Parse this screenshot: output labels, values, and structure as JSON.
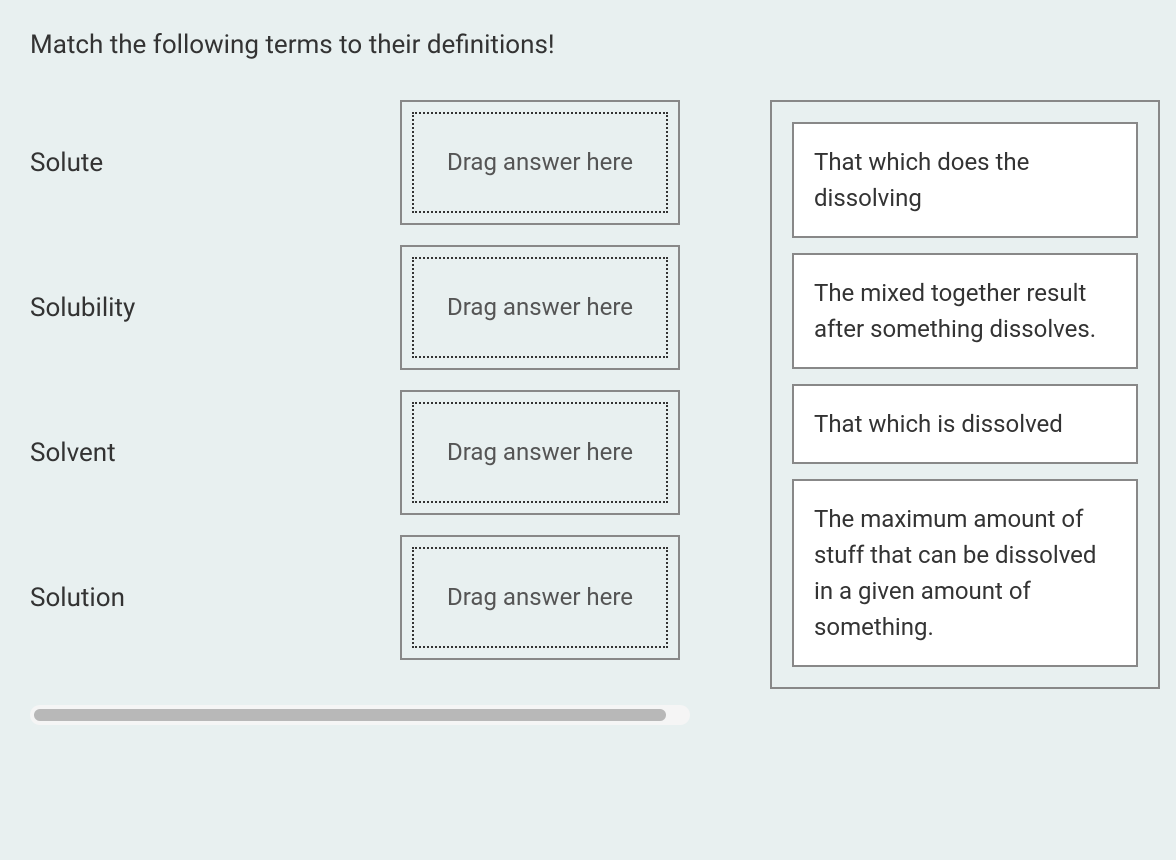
{
  "instruction": "Match the following terms to their definitions!",
  "terms": [
    {
      "label": "Solute"
    },
    {
      "label": "Solubility"
    },
    {
      "label": "Solvent"
    },
    {
      "label": "Solution"
    }
  ],
  "drop_placeholder": "Drag answer here",
  "answers": [
    {
      "text": "That which does the dissolving"
    },
    {
      "text": "The mixed together result after something dissolves."
    },
    {
      "text": "That which is dissolved"
    },
    {
      "text": "The maximum amount of stuff that can be dissolved in a given amount of something."
    }
  ]
}
